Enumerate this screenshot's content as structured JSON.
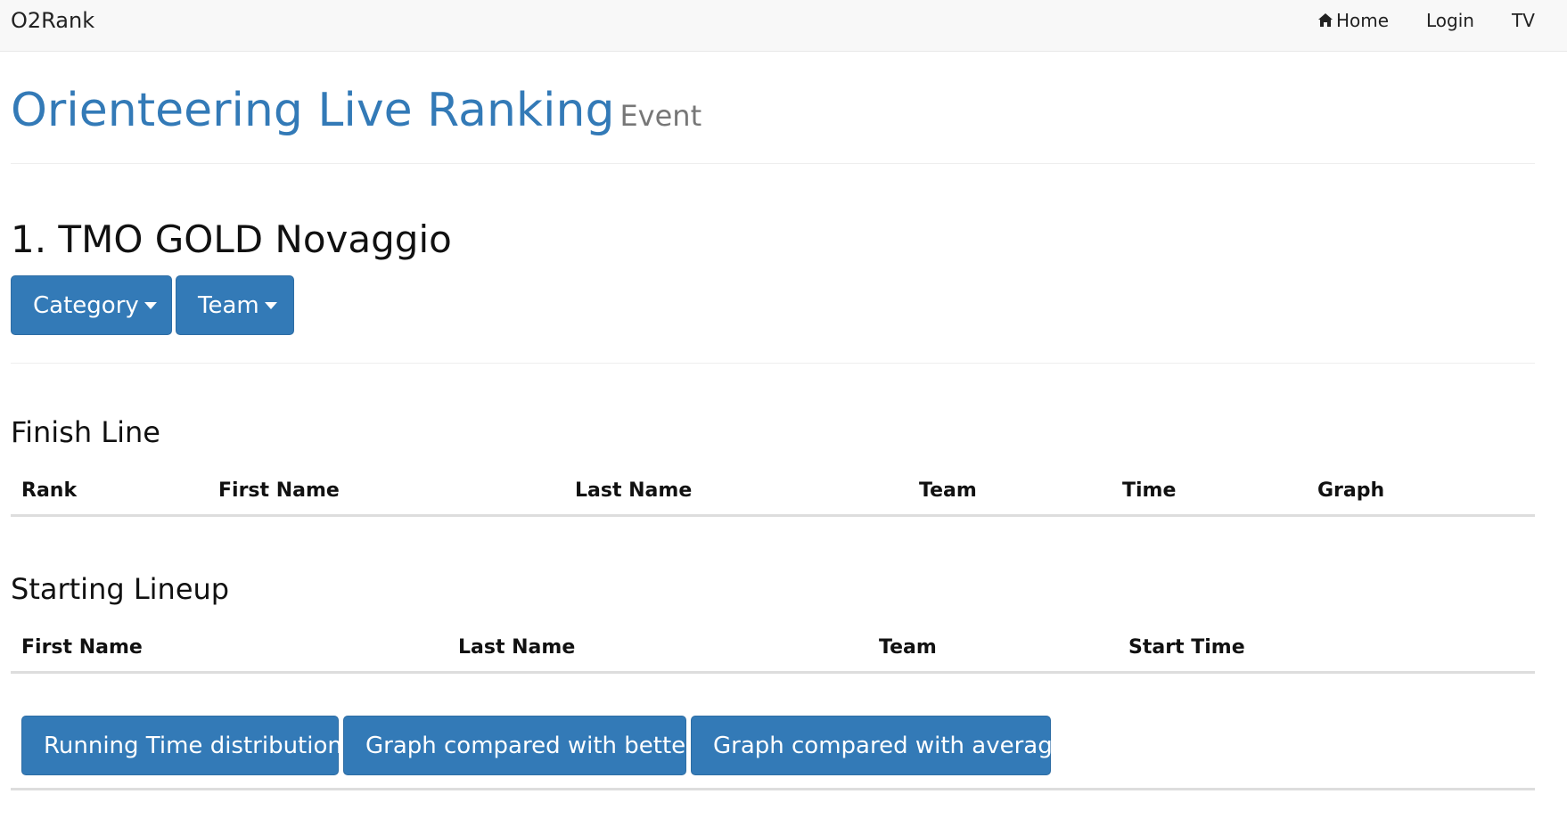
{
  "navbar": {
    "brand": "O2Rank",
    "links": [
      {
        "label": "Home",
        "icon": "home-icon"
      },
      {
        "label": "Login"
      },
      {
        "label": "TV"
      }
    ]
  },
  "page": {
    "title": "Orienteering Live Ranking",
    "subtitle": "Event",
    "event_title": "1. TMO GOLD Novaggio"
  },
  "filters": {
    "category_label": "Category",
    "team_label": "Team"
  },
  "finish_line": {
    "title": "Finish Line",
    "columns": [
      "Rank",
      "First Name",
      "Last Name",
      "Team",
      "Time",
      "Graph"
    ],
    "rows": []
  },
  "starting_lineup": {
    "title": "Starting Lineup",
    "columns": [
      "First Name",
      "Last Name",
      "Team",
      "Start Time"
    ],
    "rows": []
  },
  "actions": {
    "running_time": "Running Time distribution",
    "compare_better": "Graph compared with better",
    "compare_average": "Graph compared with average"
  },
  "colors": {
    "primary": "#337ab7",
    "navbar_bg": "#f8f8f8",
    "subtitle": "#777777"
  }
}
